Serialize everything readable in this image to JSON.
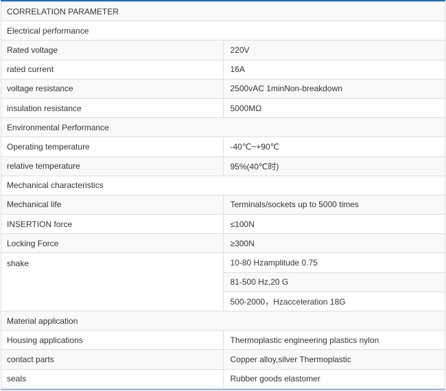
{
  "table": {
    "header": "CORRELATION  PARAMETER",
    "sections": {
      "electrical": "Electrical performance",
      "environmental": "Environmental Performance",
      "mechanical": "Mechanical characteristics",
      "material": "Material application"
    },
    "rows": {
      "rated_voltage": {
        "label": "Rated voltage",
        "value": "220V"
      },
      "rated_current": {
        "label": "rated current",
        "value": "16A"
      },
      "voltage_resistance": {
        "label": "voltage resistance",
        "value": "2500vAC 1minNon-breakdown"
      },
      "insulation_resistance": {
        "label": "insulation resistance",
        "value": "5000MΩ"
      },
      "operating_temperature": {
        "label": "Operating temperature",
        "value": "-40℃~+90℃"
      },
      "relative_temperature": {
        "label": "relative temperature",
        "value": "95%(40℃时)"
      },
      "mechanical_life": {
        "label": "Mechanical life",
        "value": "Terminals/sockets up to 5000 times"
      },
      "insertion_force": {
        "label": "INSERTION force",
        "value": "≤100N"
      },
      "locking_force": {
        "label": "Locking Force",
        "value": "≥300N"
      },
      "shake": {
        "label": "shake",
        "values": [
          "10-80 Hzamplitude 0.75",
          "81-500 Hz,20 G",
          "500-2000，Hzacceleration 18G"
        ]
      },
      "housing_applications": {
        "label": "Housing applications",
        "value": "Thermoplastic engineering plastics nylon"
      },
      "contact_parts": {
        "label": "contact parts",
        "value": "Copper alloy,silver Thermoplastic"
      },
      "seals": {
        "label": "seals",
        "value": "Rubber goods elastomer"
      }
    }
  }
}
